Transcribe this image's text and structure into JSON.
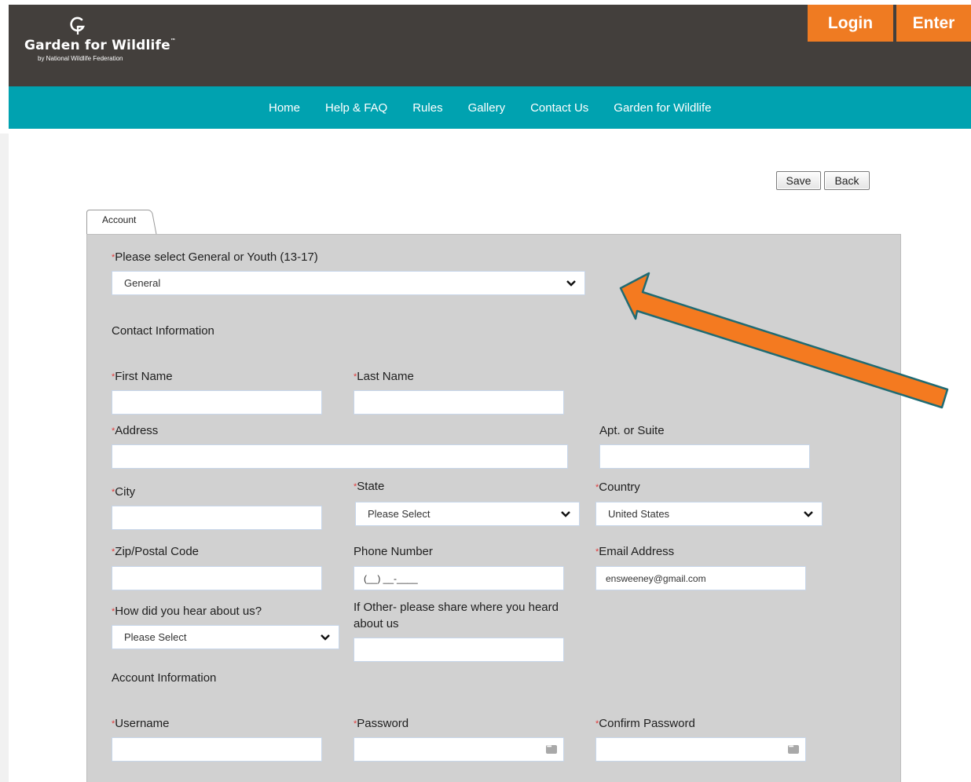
{
  "header": {
    "logo": {
      "main": "Garden for Wildlife",
      "sub": "by National Wildlife Federation",
      "tm": "™"
    },
    "login_label": "Login",
    "enter_label": "Enter"
  },
  "nav": {
    "items": [
      {
        "label": "Home"
      },
      {
        "label": "Help & FAQ"
      },
      {
        "label": "Rules"
      },
      {
        "label": "Gallery"
      },
      {
        "label": "Contact Us"
      },
      {
        "label": "Garden for Wildlife"
      }
    ]
  },
  "toolbar": {
    "save_label": "Save",
    "back_label": "Back"
  },
  "tab": {
    "label": "Account"
  },
  "form": {
    "required_mark": "*",
    "type_label": "Please select General or Youth (13-17)",
    "type_value": "General",
    "contact_section": "Contact Information",
    "first_name_label": "First Name",
    "last_name_label": "Last Name",
    "address_label": "Address",
    "apt_label": "Apt. or Suite",
    "city_label": "City",
    "state_label": "State",
    "state_value": "Please Select",
    "country_label": "Country",
    "country_value": "United States",
    "zip_label": "Zip/Postal Code",
    "phone_label": "Phone Number",
    "phone_value": "(__) __-____",
    "email_label": "Email Address",
    "email_value": "ensweeney@gmail.com",
    "hear_label": "How did you hear about us?",
    "hear_value": "Please Select",
    "other_label_line1": "If Other- please share where you heard",
    "other_label_line2": "about us",
    "account_section": "Account Information",
    "username_label": "Username",
    "password_label": "Password",
    "confirm_label": "Confirm Password"
  },
  "colors": {
    "header_bg": "#433f3c",
    "accent_orange": "#ef7b22",
    "nav_teal": "#00a2b0",
    "panel_gray": "#d1d1d1"
  },
  "icons": [
    "leaf-logo-icon",
    "chevron-down-icon",
    "password-key-icon",
    "annotation-arrow-icon"
  ]
}
